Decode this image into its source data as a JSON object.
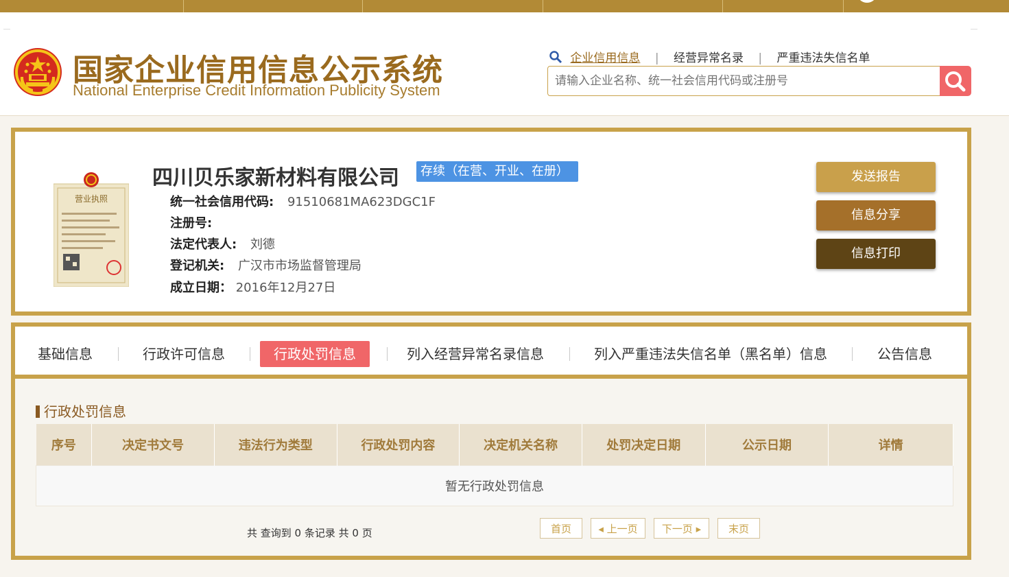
{
  "header": {
    "title_cn": "国家企业信用信息公示系统",
    "title_en": "National Enterprise Credit Information Publicity System",
    "search_tabs": [
      "企业信用信息",
      "经营异常名录",
      "严重违法失信名单"
    ],
    "search_placeholder": "请输入企业名称、统一社会信用代码或注册号"
  },
  "company": {
    "name": "四川贝乐家新材料有限公司",
    "status": "存续（在营、开业、在册）",
    "fields": [
      {
        "key": "统一社会信用代码:",
        "value": "91510681MA623DGC1F"
      },
      {
        "key": "注册号:",
        "value": ""
      },
      {
        "key": "法定代表人:",
        "value": "刘德"
      },
      {
        "key": "登记机关:",
        "value": "广汉市市场监督管理局"
      },
      {
        "key": "成立日期：",
        "value": "2016年12月27日"
      }
    ],
    "license_title": "营业执照",
    "buttons": {
      "send": "发送报告",
      "share": "信息分享",
      "print": "信息打印"
    }
  },
  "tabs": [
    "基础信息",
    "行政许可信息",
    "行政处罚信息",
    "列入经营异常名录信息",
    "列入严重违法失信名单（黑名单）信息",
    "公告信息"
  ],
  "active_tab": "行政处罚信息",
  "section": {
    "title": "行政处罚信息",
    "columns": [
      "序号",
      "决定书文号",
      "违法行为类型",
      "行政处罚内容",
      "决定机关名称",
      "处罚决定日期",
      "公示日期",
      "详情"
    ],
    "empty_text": "暂无行政处罚信息"
  },
  "pagination": {
    "summary": "共 查询到 0 条记录 共 0 页",
    "first": "首页",
    "prev": "上一页",
    "next": "下一页",
    "last": "末页"
  },
  "colors": {
    "gold": "#c8a24a",
    "active_tab": "#f06668",
    "badge": "#4d93e3"
  }
}
